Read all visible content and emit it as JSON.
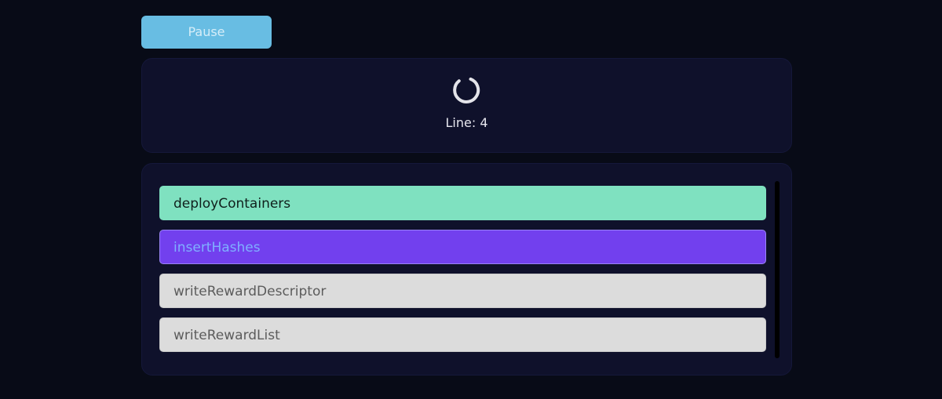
{
  "controls": {
    "pause_label": "Pause"
  },
  "status": {
    "line_text": "Line: 4"
  },
  "tasks": [
    {
      "label": "deployContainers",
      "state": "done"
    },
    {
      "label": "insertHashes",
      "state": "active"
    },
    {
      "label": "writeRewardDescriptor",
      "state": "pending"
    },
    {
      "label": "writeRewardList",
      "state": "pending"
    }
  ],
  "colors": {
    "background": "#080b17",
    "panel": "#0f112b",
    "pause_button": "#68bde3",
    "task_done": "#7fe1c0",
    "task_active": "#7240ee",
    "task_pending": "#dcdcdc"
  },
  "icons": {
    "spinner": "loading-spinner-icon"
  }
}
